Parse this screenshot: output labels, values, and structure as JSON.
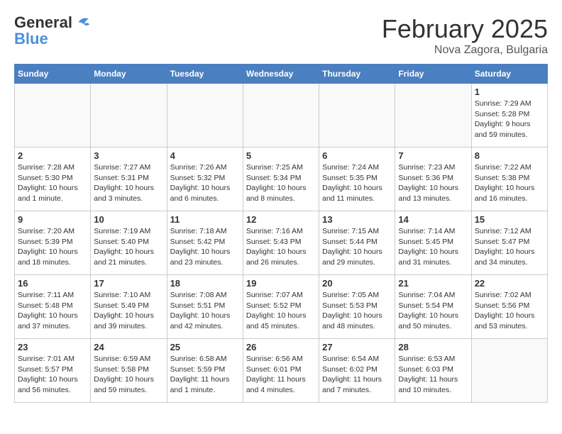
{
  "header": {
    "logo_general": "General",
    "logo_blue": "Blue",
    "month_title": "February 2025",
    "location": "Nova Zagora, Bulgaria"
  },
  "days_of_week": [
    "Sunday",
    "Monday",
    "Tuesday",
    "Wednesday",
    "Thursday",
    "Friday",
    "Saturday"
  ],
  "weeks": [
    [
      {
        "day": "",
        "info": ""
      },
      {
        "day": "",
        "info": ""
      },
      {
        "day": "",
        "info": ""
      },
      {
        "day": "",
        "info": ""
      },
      {
        "day": "",
        "info": ""
      },
      {
        "day": "",
        "info": ""
      },
      {
        "day": "1",
        "info": "Sunrise: 7:29 AM\nSunset: 5:28 PM\nDaylight: 9 hours and 59 minutes."
      }
    ],
    [
      {
        "day": "2",
        "info": "Sunrise: 7:28 AM\nSunset: 5:30 PM\nDaylight: 10 hours and 1 minute."
      },
      {
        "day": "3",
        "info": "Sunrise: 7:27 AM\nSunset: 5:31 PM\nDaylight: 10 hours and 3 minutes."
      },
      {
        "day": "4",
        "info": "Sunrise: 7:26 AM\nSunset: 5:32 PM\nDaylight: 10 hours and 6 minutes."
      },
      {
        "day": "5",
        "info": "Sunrise: 7:25 AM\nSunset: 5:34 PM\nDaylight: 10 hours and 8 minutes."
      },
      {
        "day": "6",
        "info": "Sunrise: 7:24 AM\nSunset: 5:35 PM\nDaylight: 10 hours and 11 minutes."
      },
      {
        "day": "7",
        "info": "Sunrise: 7:23 AM\nSunset: 5:36 PM\nDaylight: 10 hours and 13 minutes."
      },
      {
        "day": "8",
        "info": "Sunrise: 7:22 AM\nSunset: 5:38 PM\nDaylight: 10 hours and 16 minutes."
      }
    ],
    [
      {
        "day": "9",
        "info": "Sunrise: 7:20 AM\nSunset: 5:39 PM\nDaylight: 10 hours and 18 minutes."
      },
      {
        "day": "10",
        "info": "Sunrise: 7:19 AM\nSunset: 5:40 PM\nDaylight: 10 hours and 21 minutes."
      },
      {
        "day": "11",
        "info": "Sunrise: 7:18 AM\nSunset: 5:42 PM\nDaylight: 10 hours and 23 minutes."
      },
      {
        "day": "12",
        "info": "Sunrise: 7:16 AM\nSunset: 5:43 PM\nDaylight: 10 hours and 26 minutes."
      },
      {
        "day": "13",
        "info": "Sunrise: 7:15 AM\nSunset: 5:44 PM\nDaylight: 10 hours and 29 minutes."
      },
      {
        "day": "14",
        "info": "Sunrise: 7:14 AM\nSunset: 5:45 PM\nDaylight: 10 hours and 31 minutes."
      },
      {
        "day": "15",
        "info": "Sunrise: 7:12 AM\nSunset: 5:47 PM\nDaylight: 10 hours and 34 minutes."
      }
    ],
    [
      {
        "day": "16",
        "info": "Sunrise: 7:11 AM\nSunset: 5:48 PM\nDaylight: 10 hours and 37 minutes."
      },
      {
        "day": "17",
        "info": "Sunrise: 7:10 AM\nSunset: 5:49 PM\nDaylight: 10 hours and 39 minutes."
      },
      {
        "day": "18",
        "info": "Sunrise: 7:08 AM\nSunset: 5:51 PM\nDaylight: 10 hours and 42 minutes."
      },
      {
        "day": "19",
        "info": "Sunrise: 7:07 AM\nSunset: 5:52 PM\nDaylight: 10 hours and 45 minutes."
      },
      {
        "day": "20",
        "info": "Sunrise: 7:05 AM\nSunset: 5:53 PM\nDaylight: 10 hours and 48 minutes."
      },
      {
        "day": "21",
        "info": "Sunrise: 7:04 AM\nSunset: 5:54 PM\nDaylight: 10 hours and 50 minutes."
      },
      {
        "day": "22",
        "info": "Sunrise: 7:02 AM\nSunset: 5:56 PM\nDaylight: 10 hours and 53 minutes."
      }
    ],
    [
      {
        "day": "23",
        "info": "Sunrise: 7:01 AM\nSunset: 5:57 PM\nDaylight: 10 hours and 56 minutes."
      },
      {
        "day": "24",
        "info": "Sunrise: 6:59 AM\nSunset: 5:58 PM\nDaylight: 10 hours and 59 minutes."
      },
      {
        "day": "25",
        "info": "Sunrise: 6:58 AM\nSunset: 5:59 PM\nDaylight: 11 hours and 1 minute."
      },
      {
        "day": "26",
        "info": "Sunrise: 6:56 AM\nSunset: 6:01 PM\nDaylight: 11 hours and 4 minutes."
      },
      {
        "day": "27",
        "info": "Sunrise: 6:54 AM\nSunset: 6:02 PM\nDaylight: 11 hours and 7 minutes."
      },
      {
        "day": "28",
        "info": "Sunrise: 6:53 AM\nSunset: 6:03 PM\nDaylight: 11 hours and 10 minutes."
      },
      {
        "day": "",
        "info": ""
      }
    ]
  ]
}
